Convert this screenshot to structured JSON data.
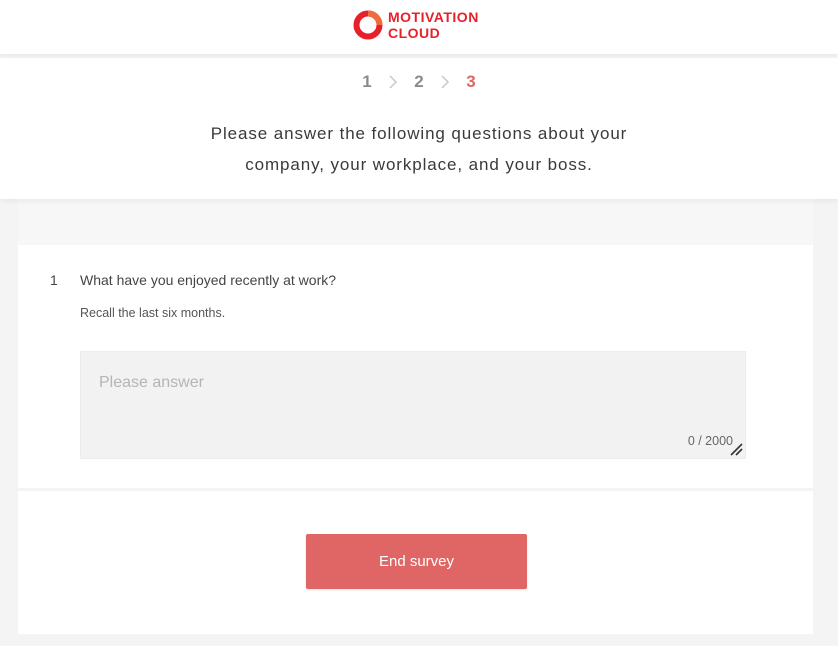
{
  "header": {
    "logo_line1": "MOTIVATION",
    "logo_line2": "CLOUD",
    "brand_color": "#e8202a"
  },
  "steps": {
    "items": [
      "1",
      "2",
      "3"
    ],
    "active_index": 2,
    "active_color": "#e06464",
    "separator_icon": "chevron-right-icon"
  },
  "intro": {
    "line1": "Please answer the following questions about your",
    "line2": "company, your workplace, and your boss."
  },
  "question": {
    "number": "1",
    "title": "What have you enjoyed recently at work?",
    "subtitle": "Recall the last six months.",
    "answer_value": "",
    "answer_placeholder": "Please answer",
    "counter": "0 / 2000"
  },
  "footer": {
    "end_button_label": "End survey",
    "button_color": "#e06666"
  }
}
